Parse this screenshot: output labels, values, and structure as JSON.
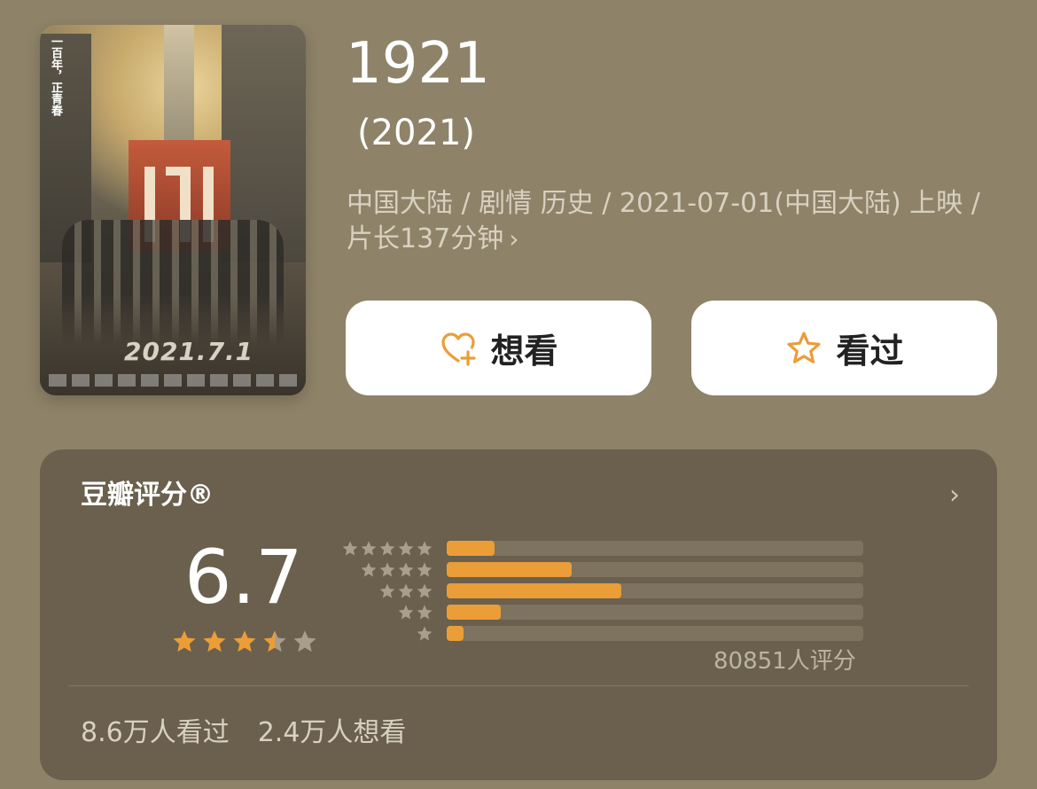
{
  "movie": {
    "title": "1921",
    "year": "(2021)",
    "meta": "中国大陆 / 剧情 历史 / 2021-07-01(中国大陆) 上映 / 片长137分钟",
    "poster": {
      "vertical_text": "一百年，正青春",
      "date_text": "2021.7.1"
    }
  },
  "actions": {
    "want_label": "想看",
    "seen_label": "看过"
  },
  "rating": {
    "title": "豆瓣评分®",
    "score": "6.7",
    "score_stars": 3.5,
    "distribution": [
      {
        "stars": 5,
        "fraction": 0.115
      },
      {
        "stars": 4,
        "fraction": 0.3
      },
      {
        "stars": 3,
        "fraction": 0.42
      },
      {
        "stars": 2,
        "fraction": 0.13
      },
      {
        "stars": 1,
        "fraction": 0.04
      }
    ],
    "count": "80851人评分"
  },
  "stats": {
    "seen": "8.6万人看过",
    "want": "2.4万人想看"
  },
  "colors": {
    "background": "#8e8268",
    "card": "#6a604d",
    "accent": "#eb9d38"
  }
}
